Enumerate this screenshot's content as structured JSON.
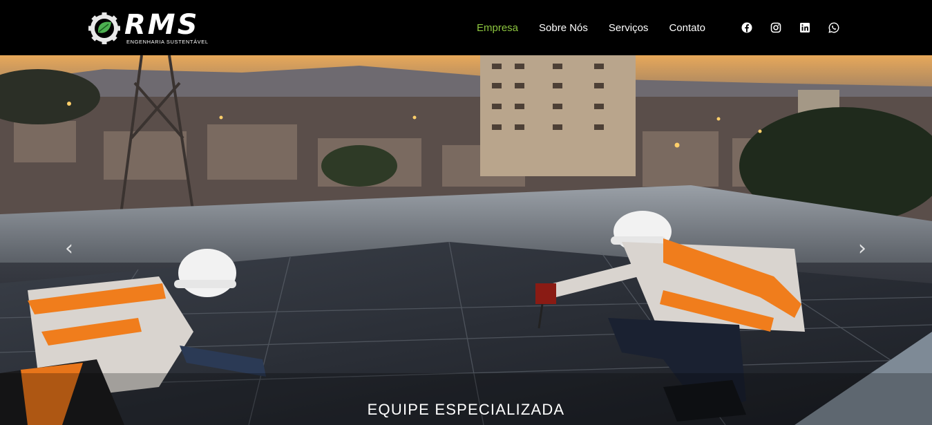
{
  "brand": {
    "name": "RMS",
    "tagline": "ENGENHARIA SUSTENTÁVEL",
    "logo_icon": "gear-leaf-icon",
    "accent": "#8dc63f"
  },
  "nav": {
    "items": [
      {
        "label": "Empresa",
        "active": true
      },
      {
        "label": "Sobre Nós",
        "active": false
      },
      {
        "label": "Serviços",
        "active": false
      },
      {
        "label": "Contato",
        "active": false
      }
    ]
  },
  "social": {
    "icons": [
      "facebook-icon",
      "instagram-icon",
      "linkedin-icon",
      "whatsapp-icon"
    ]
  },
  "hero": {
    "caption": "EQUIPE ESPECIALIZADA",
    "prev_glyph": "‹",
    "next_glyph": "›"
  }
}
